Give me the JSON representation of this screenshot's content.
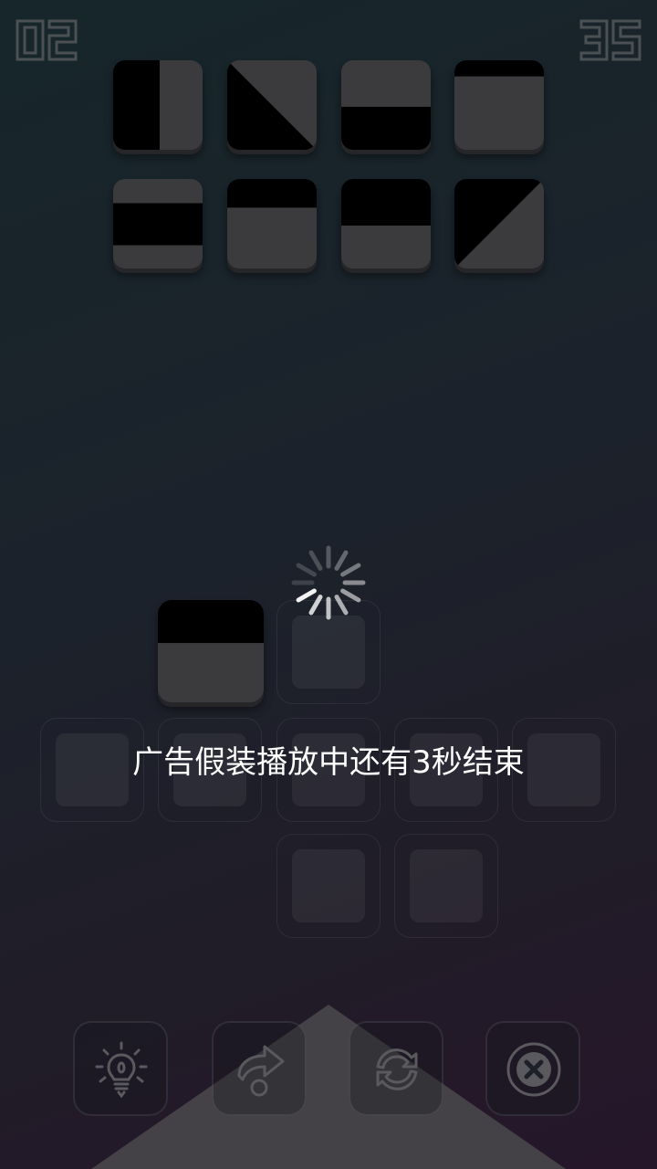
{
  "hud": {
    "level": "02",
    "moves": "35"
  },
  "toast": {
    "message": "广告假装播放中还有3秒结束"
  },
  "colors": {
    "tile_gray": "#3b3b3d",
    "tile_black": "#000000",
    "counter_stroke": "#4a5053",
    "icon_stroke": "#5a5a5e"
  },
  "target_tiles": [
    {
      "pattern": "left-half-black"
    },
    {
      "pattern": "diagonal-lower-left-black"
    },
    {
      "pattern": "bottom-half-black"
    },
    {
      "pattern": "top-strip-black"
    },
    {
      "pattern": "middle-band-black"
    },
    {
      "pattern": "top-third-black"
    },
    {
      "pattern": "top-half-black"
    },
    {
      "pattern": "diagonal-upper-left-black"
    }
  ],
  "placed_tile": {
    "pattern": "top-half-black"
  },
  "loading": {
    "icon": "spinner-icon"
  },
  "buttons": [
    {
      "icon": "lightbulb-icon",
      "action": "hint"
    },
    {
      "icon": "redo-arrow-icon",
      "action": "skip"
    },
    {
      "icon": "refresh-icon",
      "action": "restart"
    },
    {
      "icon": "close-icon",
      "action": "exit"
    }
  ]
}
